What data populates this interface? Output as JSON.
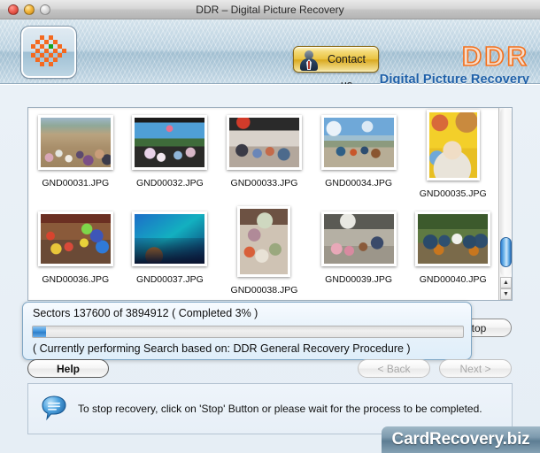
{
  "window": {
    "title": "DDR – Digital Picture Recovery",
    "traffic_lights": [
      "close",
      "minimize",
      "zoom"
    ]
  },
  "header": {
    "app_icon_name": "ddr-checkerboard-icon",
    "contact_button": "Contact us",
    "brand_title": "DDR",
    "brand_subtitle": "Digital Picture Recovery",
    "brand_color": "#f4701c",
    "brand_sub_color": "#1d5fa8"
  },
  "thumbnails": [
    {
      "label": "GND00031.JPG",
      "photo": "p1",
      "orientation": "landscape"
    },
    {
      "label": "GND00032.JPG",
      "photo": "p2",
      "orientation": "landscape"
    },
    {
      "label": "GND00033.JPG",
      "photo": "p3",
      "orientation": "landscape"
    },
    {
      "label": "GND00034.JPG",
      "photo": "p4",
      "orientation": "landscape"
    },
    {
      "label": "GND00035.JPG",
      "photo": "p5",
      "orientation": "portrait"
    },
    {
      "label": "GND00036.JPG",
      "photo": "p6",
      "orientation": "landscape"
    },
    {
      "label": "GND00037.JPG",
      "photo": "p7",
      "orientation": "landscape"
    },
    {
      "label": "GND00038.JPG",
      "photo": "p8",
      "orientation": "portrait"
    },
    {
      "label": "GND00039.JPG",
      "photo": "p9",
      "orientation": "landscape"
    },
    {
      "label": "GND00040.JPG",
      "photo": "p10",
      "orientation": "landscape"
    }
  ],
  "scrollbar": {
    "up_arrow": "▲",
    "down_arrow": "▼"
  },
  "progress": {
    "status_line": "Sectors 137600 of 3894912   ( Completed 3% )",
    "sectors_done": 137600,
    "sectors_total": 3894912,
    "percent": 3,
    "detail_line": "( Currently performing Search based on: DDR General Recovery Procedure )",
    "fill_color": "#3e93dd"
  },
  "buttons": {
    "stop": "Stop",
    "help": "Help",
    "back": "< Back",
    "next": "Next >"
  },
  "info": {
    "icon_name": "speech-bubble-icon",
    "message": "To stop recovery, click on 'Stop' Button or please wait for the process to be completed."
  },
  "watermark": {
    "text": "CardRecovery.biz"
  }
}
